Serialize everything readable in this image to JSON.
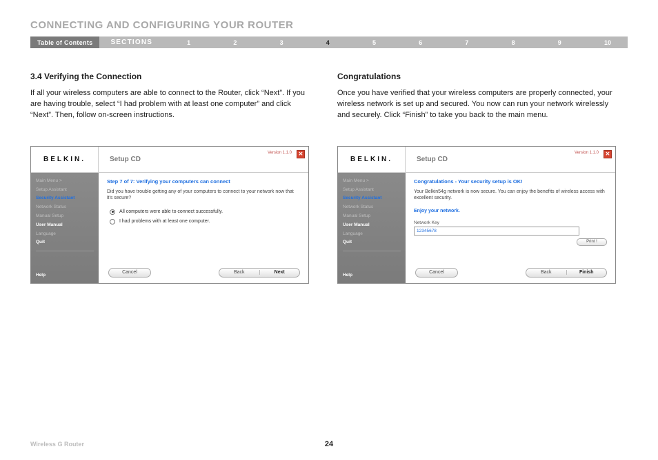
{
  "page": {
    "title": "CONNECTING AND CONFIGURING YOUR ROUTER",
    "product": "Wireless G Router",
    "page_number": "24"
  },
  "nav": {
    "toc_label": "Table of Contents",
    "sections_label": "SECTIONS",
    "numbers": [
      "1",
      "2",
      "3",
      "4",
      "5",
      "6",
      "7",
      "8",
      "9",
      "10"
    ],
    "current": "4"
  },
  "left": {
    "heading": "3.4 Verifying the Connection",
    "body": "If all your wireless computers are able to connect to the Router, click “Next”. If you are having trouble, select “I had problem with at least one computer” and click “Next”. Then, follow on-screen instructions."
  },
  "right": {
    "heading": "Congratulations",
    "body": "Once you have verified that your wireless computers are properly connected, your wireless network is set up and secured. You now can run your network wirelessly and securely. Click “Finish” to take you back to the main menu."
  },
  "shot_common": {
    "brand": "BELKIN.",
    "app_title": "Setup CD",
    "version": "Version 1.1.0",
    "sidebar": {
      "items": [
        {
          "label": "Main Menu  >"
        },
        {
          "label": "Setup Assistant"
        },
        {
          "label": "Security Assistant",
          "selected": true
        },
        {
          "label": "Network Status"
        },
        {
          "label": "Manual Setup"
        },
        {
          "label": "User Manual",
          "strong": true
        },
        {
          "label": "Language"
        },
        {
          "label": "Quit",
          "strong": true
        }
      ],
      "help": "Help"
    },
    "buttons": {
      "cancel": "Cancel",
      "back": "Back"
    }
  },
  "shot1": {
    "step_heading": "Step 7 of 7: Verifying your computers can connect",
    "question": "Did you have trouble getting any of your computers to connect to your network now that it's secure?",
    "opt1": "All computers were able to connect successfully.",
    "opt2": "I had problems with at least one computer.",
    "primary": "Next"
  },
  "shot2": {
    "step_heading": "Congratulations - Your security setup is OK!",
    "line": "Your Belkin54g network is now secure. You can enjoy the benefits of wireless access with excellent security.",
    "enjoy": "Enjoy your network.",
    "nk_label": "Network Key",
    "nk_value": "12345678",
    "print": "Print !",
    "primary": "Finish"
  }
}
